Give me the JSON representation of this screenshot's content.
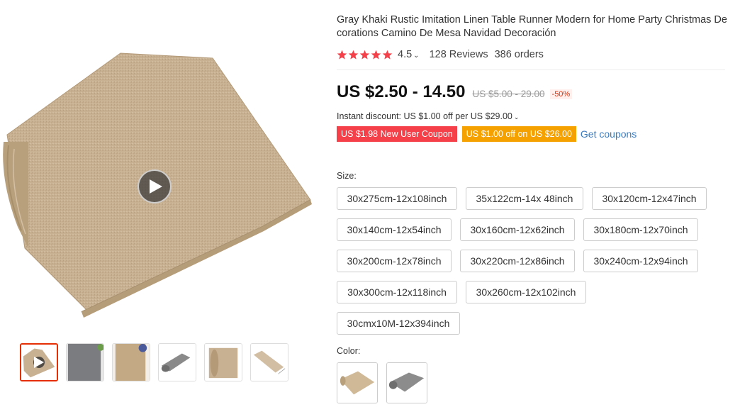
{
  "product": {
    "title": "Gray Khaki Rustic Imitation Linen Table Runner Modern for Home Party Christmas Decorations Camino De Mesa Navidad Decoración",
    "rating": "4.5",
    "reviews": "128 Reviews",
    "orders": "386 orders"
  },
  "price": {
    "current": "US $2.50 - 14.50",
    "original": "US $5.00 - 29.00",
    "discount": "-50%"
  },
  "instant_discount": "Instant discount: US $1.00 off per US $29.00",
  "coupons": {
    "new_user": "US $1.98 New User Coupon",
    "store": "US $1.00 off on US $26.00",
    "get_link": "Get coupons"
  },
  "size": {
    "label": "Size:",
    "options": [
      "30x275cm-12x108inch",
      "35x122cm-14x 48inch",
      "30x120cm-12x47inch",
      "30x140cm-12x54inch",
      "30x160cm-12x62inch",
      "30x180cm-12x70inch",
      "30x200cm-12x78inch",
      "30x220cm-12x86inch",
      "30x240cm-12x94inch",
      "30x300cm-12x118inch",
      "30x260cm-12x102inch",
      "30cmx10M-12x394inch"
    ]
  },
  "color": {
    "label": "Color:",
    "options": [
      "khaki-runner-swatch",
      "gray-runner-swatch"
    ]
  },
  "gallery": {
    "thumbnails": [
      "khaki-runner-video",
      "gray-runner-table",
      "khaki-runner-table",
      "gray-runner-roll",
      "khaki-runner-roll",
      "khaki-runner-dimensions"
    ]
  },
  "colors": {
    "accent_red": "#e62e04",
    "coupon_red": "#f5404a",
    "coupon_orange": "#f5a100",
    "link_blue": "#3a7abf",
    "star_red": "#f5404a",
    "linen_khaki": "#c9b08e",
    "linen_gray": "#8a8a8a"
  }
}
